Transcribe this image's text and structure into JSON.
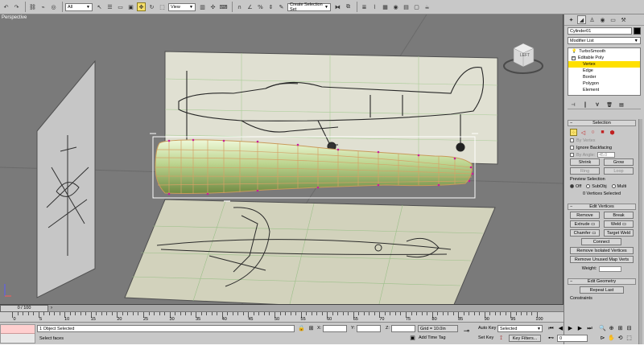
{
  "toolbar": {
    "selection_filter": "All",
    "ref_coord": "View",
    "named_selection": "Create Selection Set",
    "icons": [
      "undo-icon",
      "redo-icon",
      "link-icon",
      "unlink-icon",
      "bind-icon",
      "select-icon",
      "select-by-name-icon",
      "rect-region-icon",
      "window-crossing-icon",
      "move-icon",
      "rotate-icon",
      "scale-icon",
      "pivot-icon",
      "manipulate-icon",
      "keyboard-icon",
      "snap-icon",
      "angle-snap-icon",
      "percent-snap-icon",
      "spinner-snap-icon",
      "edit-named-icon",
      "mirror-icon",
      "align-icon",
      "layer-icon",
      "curve-editor-icon",
      "schematic-icon",
      "material-editor-icon",
      "render-setup-icon",
      "render-frame-icon",
      "render-icon"
    ]
  },
  "viewport": {
    "label": "Perspective"
  },
  "viewcube": {
    "face_label": "LEFT"
  },
  "command_panel": {
    "tabs": [
      "create-tab",
      "modify-tab",
      "hierarchy-tab",
      "motion-tab",
      "display-tab",
      "utilities-tab"
    ],
    "object_name": "Cylinder01",
    "object_color": "#000000",
    "modifier_list_label": "Modifier List",
    "stack": [
      {
        "label": "TurboSmooth",
        "level": 0,
        "icon": "bulb-icon"
      },
      {
        "label": "Editable Poly",
        "level": 0,
        "icon": "minus-icon"
      },
      {
        "label": "Vertex",
        "level": 1,
        "selected": true
      },
      {
        "label": "Edge",
        "level": 1
      },
      {
        "label": "Border",
        "level": 1
      },
      {
        "label": "Polygon",
        "level": 1
      },
      {
        "label": "Element",
        "level": 1
      }
    ],
    "selection_rollout": {
      "title": "Selection",
      "by_vertex": "By Vertex",
      "ignore_backfacing": "Ignore Backfacing",
      "by_angle": "By Angle:",
      "angle_value": "45.0",
      "shrink": "Shrink",
      "grow": "Grow",
      "ring": "Ring",
      "loop": "Loop",
      "preview_selection": "Preview Selection",
      "preview_off": "Off",
      "preview_subobj": "SubObj",
      "preview_multi": "Multi",
      "status": "0 Vertices Selected"
    },
    "edit_vertices_rollout": {
      "title": "Edit Vertices",
      "remove": "Remove",
      "break": "Break",
      "extrude": "Extrude",
      "weld": "Weld",
      "chamfer": "Chamfer",
      "target_weld": "Target Weld",
      "connect": "Connect",
      "remove_isolated": "Remove Isolated Vertices",
      "remove_unused": "Remove Unused Map Verts",
      "weight_label": "Weight:",
      "weight_value": ""
    },
    "edit_geometry_rollout": {
      "title": "Edit Geometry",
      "repeat_last": "Repeat Last",
      "constraints": "Constraints"
    }
  },
  "time_slider": {
    "label": "0 / 100"
  },
  "ruler": {
    "labels": [
      "0",
      "5",
      "10",
      "15",
      "20",
      "25",
      "30",
      "35",
      "40",
      "45",
      "50",
      "55",
      "60",
      "65",
      "70",
      "75",
      "80",
      "85",
      "90",
      "95",
      "100"
    ]
  },
  "status": {
    "selection_info": "1 Object Selected",
    "prompt": "Select faces",
    "x_label": "X:",
    "y_label": "Y:",
    "z_label": "Z:",
    "x_value": "",
    "y_value": "",
    "z_value": "",
    "grid": "Grid = 10.0in",
    "add_time_tag": "Add Time Tag",
    "auto_key": "Auto Key",
    "set_key": "Set Key",
    "key_mode": "Selected",
    "key_filters": "Key Filters...",
    "frame": "0"
  }
}
